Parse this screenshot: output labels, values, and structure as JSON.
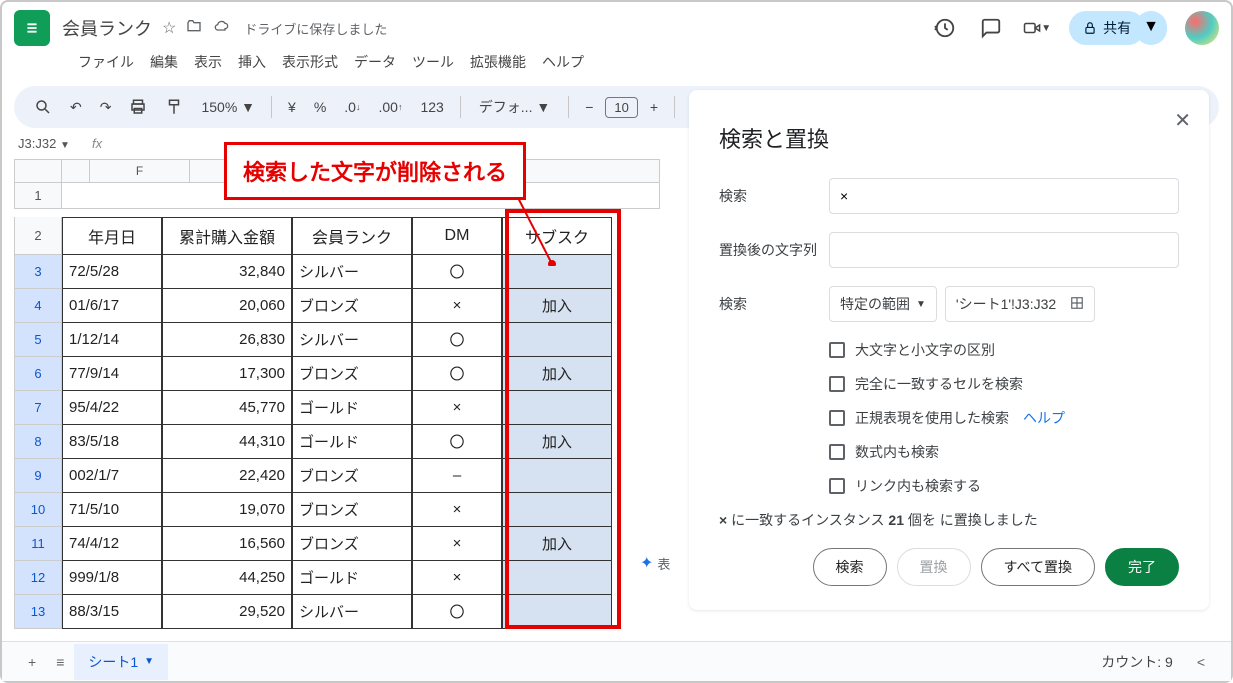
{
  "header": {
    "title": "会員ランク",
    "save_msg": "ドライブに保存しました",
    "share": "共有"
  },
  "menu": {
    "file": "ファイル",
    "edit": "編集",
    "view": "表示",
    "insert": "挿入",
    "format": "表示形式",
    "data": "データ",
    "tools": "ツール",
    "ext": "拡張機能",
    "help": "ヘルプ"
  },
  "toolbar": {
    "zoom": "150%",
    "currency": "¥",
    "percent": "%",
    "dec_dec": ".0",
    "dec_inc": ".00",
    "num123": "123",
    "font": "デフォ...",
    "size": "10"
  },
  "namebox": "J3:J32",
  "columns": {
    "F": "F",
    "h_date": "年月日",
    "h_amt": "累計購入金額",
    "h_rank": "会員ランク",
    "h_dm": "DM",
    "h_sub": "サブスク"
  },
  "row_nums": [
    "1",
    "2",
    "3",
    "4",
    "5",
    "6",
    "7",
    "8",
    "9",
    "10",
    "11",
    "12",
    "13"
  ],
  "rows": [
    {
      "date": "72/5/28",
      "amt": "32,840",
      "rank": "シルバー",
      "dm": "〇",
      "sub": ""
    },
    {
      "date": "01/6/17",
      "amt": "20,060",
      "rank": "ブロンズ",
      "dm": "×",
      "sub": "加入"
    },
    {
      "date": "1/12/14",
      "amt": "26,830",
      "rank": "シルバー",
      "dm": "〇",
      "sub": ""
    },
    {
      "date": "77/9/14",
      "amt": "17,300",
      "rank": "ブロンズ",
      "dm": "〇",
      "sub": "加入"
    },
    {
      "date": "95/4/22",
      "amt": "45,770",
      "rank": "ゴールド",
      "dm": "×",
      "sub": ""
    },
    {
      "date": "83/5/18",
      "amt": "44,310",
      "rank": "ゴールド",
      "dm": "〇",
      "sub": "加入"
    },
    {
      "date": "002/1/7",
      "amt": "22,420",
      "rank": "ブロンズ",
      "dm": "–",
      "sub": ""
    },
    {
      "date": "71/5/10",
      "amt": "19,070",
      "rank": "ブロンズ",
      "dm": "×",
      "sub": ""
    },
    {
      "date": "74/4/12",
      "amt": "16,560",
      "rank": "ブロンズ",
      "dm": "×",
      "sub": "加入"
    },
    {
      "date": "999/1/8",
      "amt": "44,250",
      "rank": "ゴールド",
      "dm": "×",
      "sub": ""
    },
    {
      "date": "88/3/15",
      "amt": "29,520",
      "rank": "シルバー",
      "dm": "〇",
      "sub": ""
    }
  ],
  "annotation": "検索した文字が削除される",
  "dialog": {
    "title": "検索と置換",
    "find_label": "検索",
    "find_value": "×",
    "replace_label": "置換後の文字列",
    "replace_value": "",
    "scope_label": "検索",
    "scope_value": "特定の範囲",
    "range_value": "'シート1'!J3:J32",
    "chk_case": "大文字と小文字の区別",
    "chk_exact": "完全に一致するセルを検索",
    "chk_regex": "正規表現を使用した検索",
    "help": "ヘルプ",
    "chk_formula": "数式内も検索",
    "chk_link": "リンク内も検索する",
    "status_prefix": "×",
    "status_mid1": " に一致するインスタンス ",
    "status_count": "21",
    "status_mid2": " 個を ",
    "status_suffix": " に置換しました",
    "btn_find": "検索",
    "btn_replace": "置換",
    "btn_replace_all": "すべて置換",
    "btn_done": "完了"
  },
  "bottom": {
    "sheet1": "シート1",
    "count": "カウント: 9",
    "explore": "表"
  }
}
